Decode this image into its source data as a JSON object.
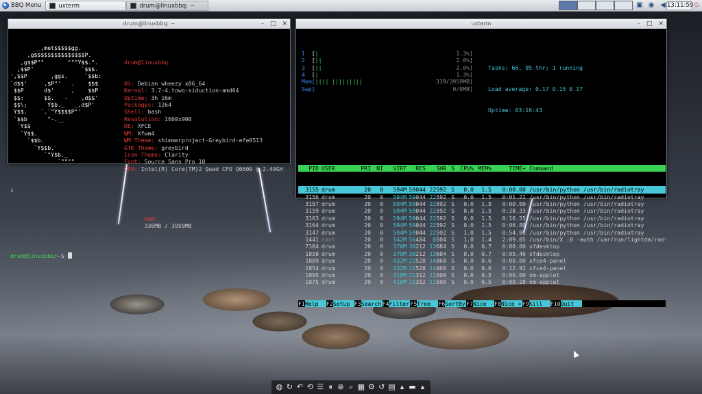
{
  "panel": {
    "menu_label": "BBQ Menu",
    "tasks": [
      {
        "label": "uxterm",
        "active": false
      },
      {
        "label": "drum@linuxbbq: ~",
        "active": true
      }
    ],
    "clock": "13:11:59"
  },
  "neofetch_window": {
    "title": "drum@linuxbbq: ~",
    "art": [
      "        _,met$$$$$gg.",
      "     ,g$$$$$$$$$$$$$$$P.",
      "   ,g$$P\"\"       \"\"\"Y$$.\".",
      "  ,$$P'              `$$$.",
      "',$$P       ,ggs.     `$$b:",
      "`d$$'     ,$P\"'   .    $$$",
      " $$P      d$'     ,    $$P",
      " $$:      $$.   -    ,d$$'",
      " $$\\;      Y$b._   _,d$P'",
      " Y$$.    `.`\"Y$$$$P\"'",
      " `$$b      \"-.__",
      "  `Y$$",
      "   `Y$$.",
      "     `$$b.",
      "       `Y$$b.",
      "          `\"Y$b._",
      "              `\"\"\"\""
    ],
    "user_host": "drum@linuxbbq",
    "info": [
      {
        "key": "OS:",
        "value": "Debian wheezy x86_64"
      },
      {
        "key": "Kernel:",
        "value": "3.7-4.towo-siduction-amd64"
      },
      {
        "key": "Uptime:",
        "value": "3h 16m"
      },
      {
        "key": "Packages:",
        "value": "1264"
      },
      {
        "key": "Shell:",
        "value": "bash"
      },
      {
        "key": "Resolution:",
        "value": "1600x900"
      },
      {
        "key": "DE:",
        "value": "XFCE"
      },
      {
        "key": "WM:",
        "value": "Xfwm4"
      },
      {
        "key": "WM Theme:",
        "value": "shimmerproject-Greybird-efe0513"
      },
      {
        "key": "GTK Theme:",
        "value": "greybird"
      },
      {
        "key": "Icon Theme:",
        "value": "Clarity"
      },
      {
        "key": "Font:",
        "value": "Source Sans Pro 10"
      },
      {
        "key": "CPU:",
        "value": "Intel(R) Core(TM)2 Quad CPU Q6600 @ 2.40GH"
      }
    ],
    "wrap_char": "z",
    "ram": {
      "key": "RAM:",
      "value": "336MB / 3959MB"
    },
    "prompt": "drum@linuxbbq",
    "prompt_suffix": ":~$ "
  },
  "htop_window": {
    "title": "uxterm",
    "cpus": [
      {
        "n": "1",
        "bar": "|",
        "pct": "1.3%]"
      },
      {
        "n": "2",
        "bar": "||",
        "pct": "2.0%]"
      },
      {
        "n": "3",
        "bar": "||",
        "pct": "2.6%]"
      },
      {
        "n": "4",
        "bar": "|",
        "pct": "1.3%]"
      }
    ],
    "mem": {
      "label": "Mem[",
      "bar": "|||| |||||||||",
      "value": "339/3959MB]"
    },
    "swp": {
      "label": "Swp[",
      "value": "0/0MB]"
    },
    "tasks_line": "Tasks: 66, 95 thr; 1 running",
    "load_line": "Load average: 0.17 0.15 0.17",
    "uptime_line": "Uptime: 03:16:43",
    "columns": [
      "PID",
      "USER",
      "PRI",
      "NI",
      "VIRT",
      "RES",
      "SHR",
      "S",
      "CPU%",
      "MEM%",
      "TIME+",
      "Command"
    ],
    "processes": [
      {
        "pid": "3155",
        "user": "drum",
        "pri": "20",
        "ni": "0",
        "virt": "594M",
        "res": "59044",
        "shr": "22592",
        "s": "S",
        "cpu": "0.0",
        "mem": "1.5",
        "time": "0:00.00",
        "cmd": "/usr/bin/python /usr/bin/radiotray",
        "selected": true
      },
      {
        "pid": "3156",
        "user": "drum",
        "pri": "20",
        "ni": "0",
        "virt": "594M",
        "res": "59044",
        "shr": "22592",
        "s": "S",
        "cpu": "0.0",
        "mem": "1.5",
        "time": "0:01.21",
        "cmd": "/usr/bin/python /usr/bin/radiotray"
      },
      {
        "pid": "3157",
        "user": "drum",
        "pri": "20",
        "ni": "0",
        "virt": "594M",
        "res": "59044",
        "shr": "22592",
        "s": "S",
        "cpu": "0.0",
        "mem": "1.5",
        "time": "0:00.00",
        "cmd": "/usr/bin/python /usr/bin/radiotray"
      },
      {
        "pid": "3159",
        "user": "drum",
        "pri": "20",
        "ni": "0",
        "virt": "594M",
        "res": "59044",
        "shr": "22592",
        "s": "S",
        "cpu": "0.0",
        "mem": "1.5",
        "time": "0:28.33",
        "cmd": "/usr/bin/python /usr/bin/radiotray"
      },
      {
        "pid": "3163",
        "user": "drum",
        "pri": "20",
        "ni": "0",
        "virt": "594M",
        "res": "59044",
        "shr": "22592",
        "s": "S",
        "cpu": "0.0",
        "mem": "1.5",
        "time": "0:16.55",
        "cmd": "/usr/bin/python /usr/bin/radiotray"
      },
      {
        "pid": "3164",
        "user": "drum",
        "pri": "20",
        "ni": "0",
        "virt": "594M",
        "res": "59044",
        "shr": "22592",
        "s": "S",
        "cpu": "0.0",
        "mem": "1.5",
        "time": "0:06.89",
        "cmd": "/usr/bin/python /usr/bin/radiotray"
      },
      {
        "pid": "3147",
        "user": "drum",
        "pri": "20",
        "ni": "0",
        "virt": "594M",
        "res": "59044",
        "shr": "22592",
        "s": "S",
        "cpu": "1.0",
        "mem": "1.5",
        "time": "0:54.96",
        "cmd": "/usr/bin/python /usr/bin/radiotray"
      },
      {
        "pid": "1441",
        "user": "root",
        "pri": "20",
        "ni": "0",
        "virt": "142M",
        "res": "56484",
        "shr": "8504",
        "s": "S",
        "cpu": "1.0",
        "mem": "1.4",
        "time": "2:09.05",
        "cmd": "/usr/bin/X :0 -auth /var/run/lightdm/root/"
      },
      {
        "pid": "7104",
        "user": "drum",
        "pri": "20",
        "ni": "0",
        "virt": "370M",
        "res": "30212",
        "shr": "13684",
        "s": "S",
        "cpu": "0.0",
        "mem": "0.7",
        "time": "0:00.00",
        "cmd": "xfdesktop"
      },
      {
        "pid": "1858",
        "user": "drum",
        "pri": "20",
        "ni": "0",
        "virt": "370M",
        "res": "30212",
        "shr": "13684",
        "s": "S",
        "cpu": "0.0",
        "mem": "0.7",
        "time": "0:05.46",
        "cmd": "xfdesktop"
      },
      {
        "pid": "1889",
        "user": "drum",
        "pri": "20",
        "ni": "0",
        "virt": "432M",
        "res": "22528",
        "shr": "14068",
        "s": "S",
        "cpu": "0.0",
        "mem": "0.6",
        "time": "0:00.00",
        "cmd": "xfce4-panel"
      },
      {
        "pid": "1854",
        "user": "drum",
        "pri": "20",
        "ni": "0",
        "virt": "432M",
        "res": "22528",
        "shr": "14068",
        "s": "S",
        "cpu": "0.0",
        "mem": "0.6",
        "time": "0:12.92",
        "cmd": "xfce4-panel"
      },
      {
        "pid": "1895",
        "user": "drum",
        "pri": "20",
        "ni": "0",
        "virt": "418M",
        "res": "21312",
        "shr": "11500",
        "s": "S",
        "cpu": "0.0",
        "mem": "0.5",
        "time": "0:00.00",
        "cmd": "nm-applet"
      },
      {
        "pid": "1875",
        "user": "drum",
        "pri": "20",
        "ni": "0",
        "virt": "418M",
        "res": "21312",
        "shr": "11500",
        "s": "S",
        "cpu": "0.0",
        "mem": "0.5",
        "time": "0:00.28",
        "cmd": "nm-applet"
      }
    ],
    "fkeys": [
      {
        "k": "F1",
        "l": "Help"
      },
      {
        "k": "F2",
        "l": "Setup"
      },
      {
        "k": "F3",
        "l": "Search"
      },
      {
        "k": "F4",
        "l": "Filter"
      },
      {
        "k": "F5",
        "l": "Tree"
      },
      {
        "k": "F6",
        "l": "SortBy"
      },
      {
        "k": "F7",
        "l": "Nice -"
      },
      {
        "k": "F8",
        "l": "Nice +"
      },
      {
        "k": "F9",
        "l": "Kill"
      },
      {
        "k": "F10",
        "l": "Quit"
      }
    ]
  },
  "dock_icons": [
    "globe-icon",
    "refresh-icon",
    "undo-icon",
    "history-icon",
    "list-icon",
    "pause-icon",
    "network-icon",
    "search-icon",
    "screenshot-icon",
    "settings-icon",
    "reload-icon",
    "document-icon",
    "up-icon",
    "chat-icon",
    "up-icon"
  ],
  "colors": {
    "accent_green": "#39d353",
    "accent_cyan": "#46c8d8",
    "red": "#e03a3a"
  }
}
